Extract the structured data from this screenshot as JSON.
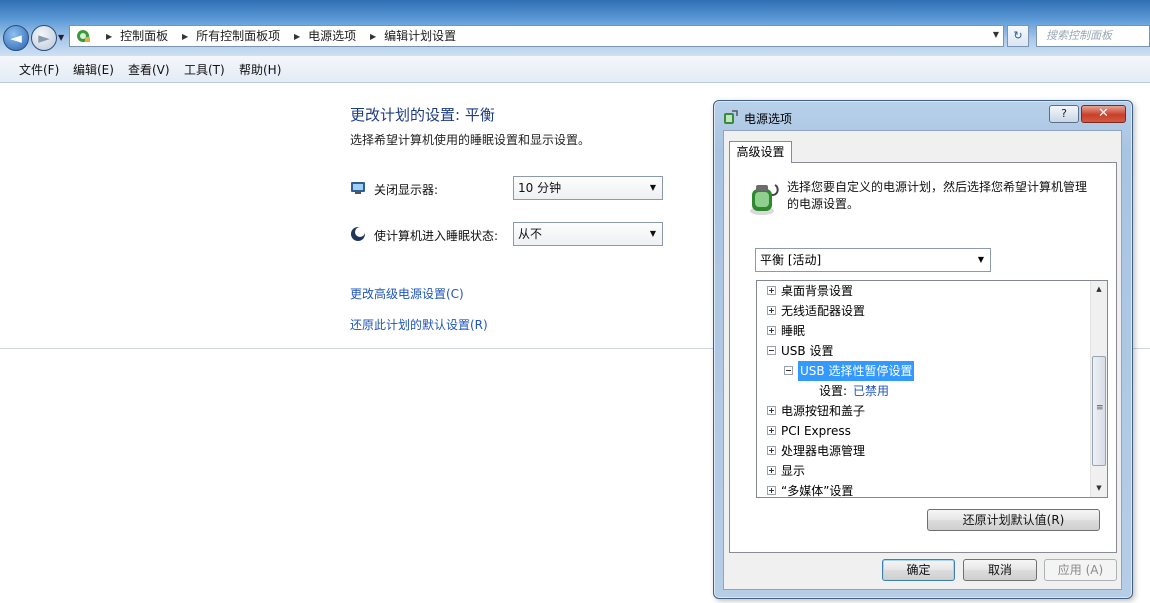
{
  "address_bar": {
    "breadcrumbs": [
      "控制面板",
      "所有控制面板项",
      "电源选项",
      "编辑计划设置"
    ],
    "search_placeholder": "搜索控制面板"
  },
  "menu": [
    "文件(F)",
    "编辑(E)",
    "查看(V)",
    "工具(T)",
    "帮助(H)"
  ],
  "main": {
    "title": "更改计划的设置: 平衡",
    "subtitle": "选择希望计算机使用的睡眠设置和显示设置。",
    "display_off": {
      "label": "关闭显示器:",
      "value": "10 分钟",
      "icon": "monitor-icon"
    },
    "sleep": {
      "label": "使计算机进入睡眠状态:",
      "value": "从不",
      "icon": "sleep-moon-icon"
    },
    "link_advanced": "更改高级电源设置(C)",
    "link_restore": "还原此计划的默认设置(R)"
  },
  "dialog": {
    "title": "电源选项",
    "help": "?",
    "close": "✕",
    "tab": "高级设置",
    "description": "选择您要自定义的电源计划，然后选择您希望计算机管理的电源设置。",
    "plan_selected": "平衡 [活动]",
    "tree": [
      {
        "label": "桌面背景设置",
        "expanded": false,
        "level": 0
      },
      {
        "label": "无线适配器设置",
        "expanded": false,
        "level": 0
      },
      {
        "label": "睡眠",
        "expanded": false,
        "level": 0
      },
      {
        "label": "USB 设置",
        "expanded": true,
        "level": 0
      },
      {
        "label": "USB 选择性暂停设置",
        "expanded": true,
        "level": 1,
        "selected": true
      },
      {
        "label": "设置:",
        "value": "已禁用",
        "level": 2
      },
      {
        "label": "电源按钮和盖子",
        "expanded": false,
        "level": 0
      },
      {
        "label": "PCI Express",
        "expanded": false,
        "level": 0
      },
      {
        "label": "处理器电源管理",
        "expanded": false,
        "level": 0
      },
      {
        "label": "显示",
        "expanded": false,
        "level": 0
      },
      {
        "label": "“多媒体”设置",
        "expanded": false,
        "level": 0
      }
    ],
    "restore_button": "还原计划默认值(R)",
    "ok_button": "确定",
    "cancel_button": "取消",
    "apply_button": "应用 (A)"
  }
}
